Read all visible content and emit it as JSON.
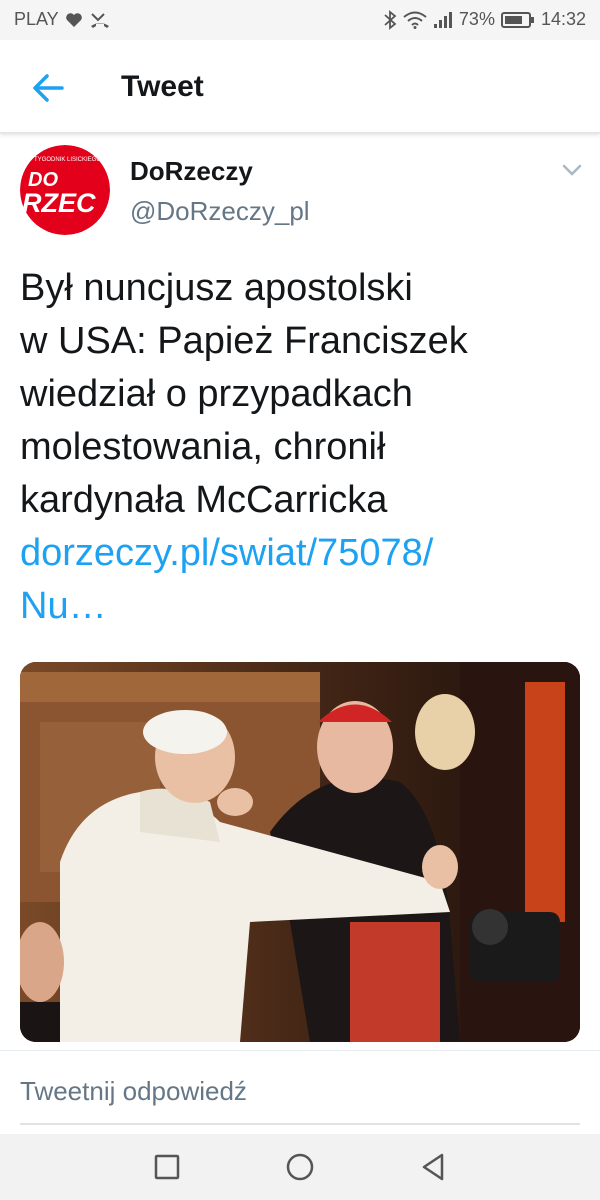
{
  "status_bar": {
    "carrier": "PLAY",
    "battery": "73%",
    "time": "14:32",
    "icons": [
      "heart-icon",
      "missed-call-icon",
      "bluetooth-icon",
      "wifi-icon",
      "signal-icon",
      "battery-icon"
    ]
  },
  "app_bar": {
    "title": "Tweet",
    "back_icon": "arrow-left-icon",
    "accent_color": "#1da1f2"
  },
  "tweet": {
    "author_name": "DoRzeczy",
    "author_handle": "@DoRzeczy_pl",
    "avatar_text_top": "TYGODNIK LISICKIEGO",
    "avatar_text_main": "DO RZECZY",
    "menu_icon": "chevron-down-icon",
    "text_lines": [
      "Był nuncjusz apostolski",
      "w USA: Papież Franciszek",
      "wiedział o przypadkach",
      "molestowania, chronił",
      "kardynała McCarricka"
    ],
    "link_lines": [
      "dorzeczy.pl/swiat/75078/",
      "Nu…"
    ]
  },
  "reply": {
    "placeholder": "Tweetnij odpowiedź"
  },
  "nav_bar": {
    "icons": [
      "recent-apps-icon",
      "home-icon",
      "back-triangle-icon"
    ]
  }
}
